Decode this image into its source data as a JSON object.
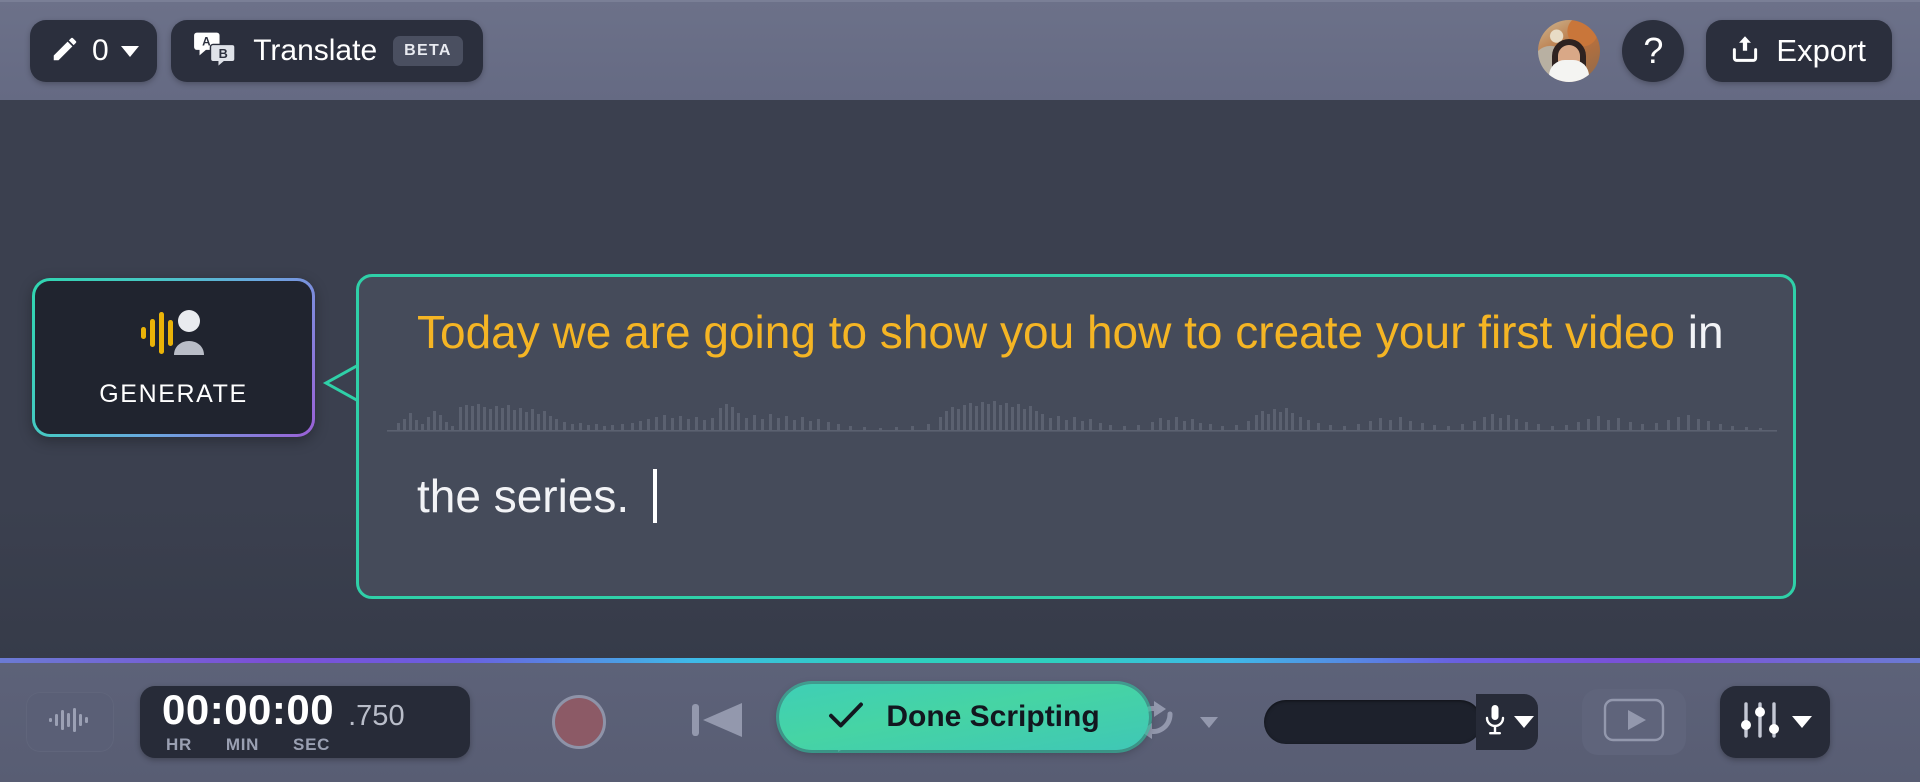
{
  "topbar": {
    "pen_tool": {
      "icon": "pencil-icon",
      "count": "0",
      "dropdown": "chevron-down-icon"
    },
    "translate": {
      "icon": "translate-ab-icon",
      "label": "Translate",
      "badge": "BETA"
    },
    "avatar": {
      "name": "user-avatar"
    },
    "help": {
      "label": "?"
    },
    "export": {
      "icon": "upload-icon",
      "label": "Export"
    }
  },
  "generate": {
    "icon": "voice-person-icon",
    "label": "GENERATE",
    "border_gradient_from": "#2fd6b0",
    "border_gradient_to": "#9b5fd6"
  },
  "script": {
    "border_color": "#2fd0a8",
    "highlight_color": "#f5b524",
    "text_color": "#f2f3f6",
    "line1_highlighted": "Today we are going to show you how to create your first video",
    "line1_plain": "in",
    "line2": "the series.",
    "cursor": "text-caret",
    "full_text": "Today we are going to show you how to create your first video in the series."
  },
  "done_scripting": {
    "icon": "check-icon",
    "label": "Done Scripting",
    "gradient_from": "#3fcfb6",
    "gradient_to": "#46d4a4"
  },
  "separator": {
    "gradient": "#7c4fd6 #3fb9e8 #2fd0c0"
  },
  "transport": {
    "audio_icon": "waveform-icon",
    "timecode": {
      "digits": "00:00:00",
      "milliseconds": ".750",
      "unit_hr": "HR",
      "unit_min": "MIN",
      "unit_sec": "SEC"
    },
    "record": "record-icon",
    "skip_back": "skip-back-icon",
    "play": "play-icon",
    "skip_forward": "skip-forward-icon",
    "loop": "loop-icon",
    "loop_dropdown": "chevron-down-icon",
    "input_meter": "level-meter",
    "mic": "microphone-icon",
    "mic_dropdown": "chevron-down-icon",
    "preview": "video-preview-icon",
    "mixer": "mixer-faders-icon",
    "mixer_dropdown": "chevron-down-icon"
  }
}
